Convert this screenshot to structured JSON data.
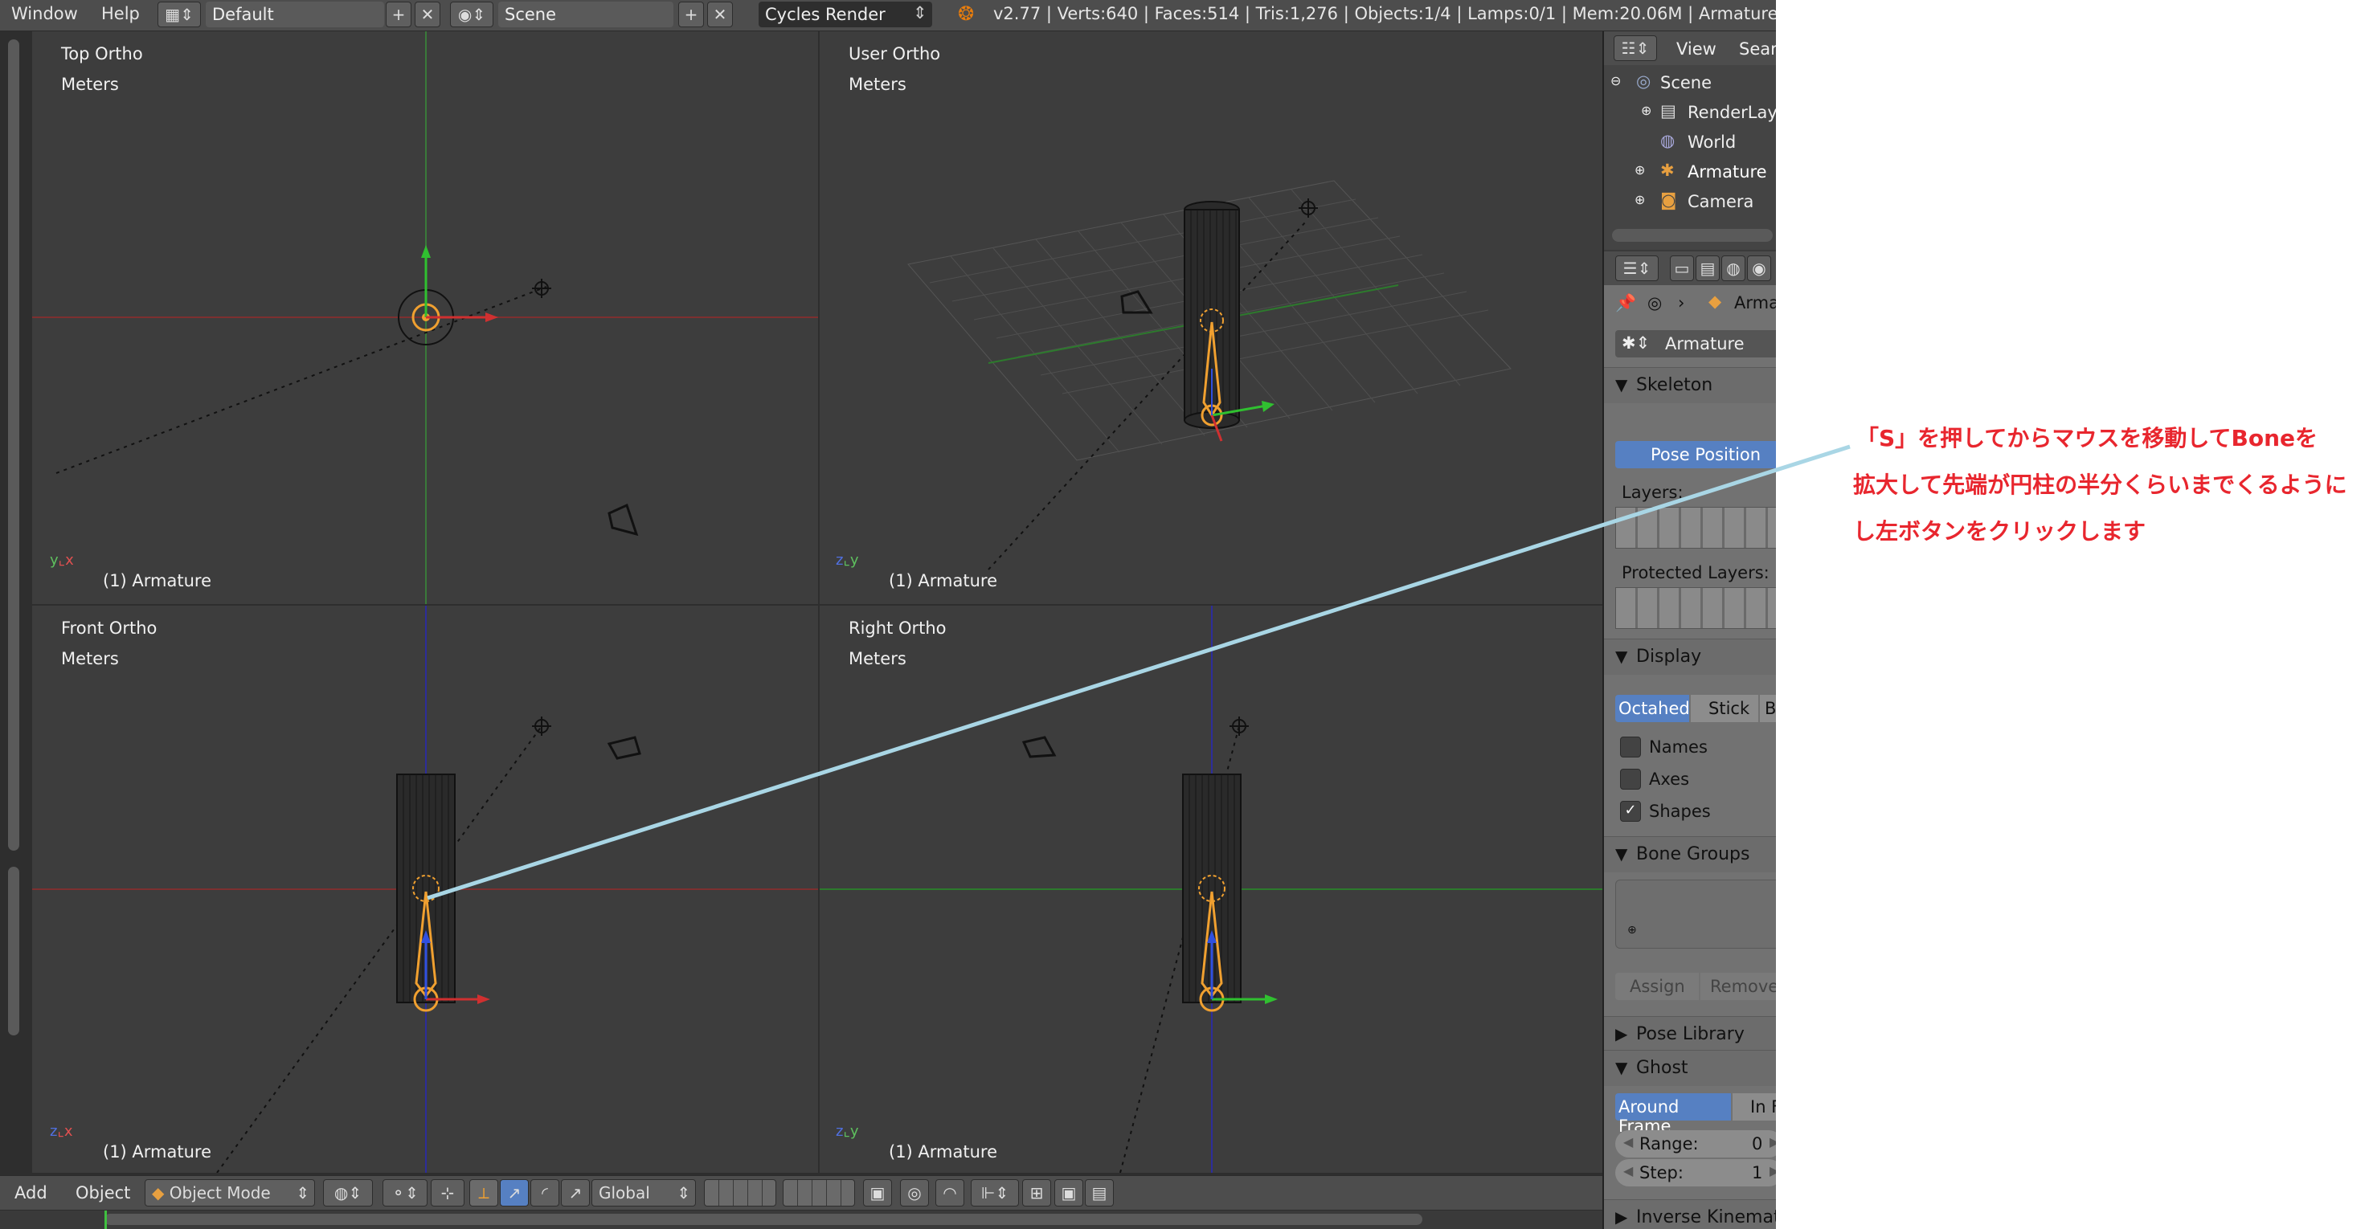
{
  "header": {
    "menu": [
      "Window",
      "Help"
    ],
    "layout": "Default",
    "scene": "Scene",
    "engine": "Cycles Render",
    "stats": "v2.77 | Verts:640 | Faces:514 | Tris:1,276 | Objects:1/4 | Lamps:0/1 | Mem:20.06M | Armature"
  },
  "viewports": [
    {
      "view": "Top Ortho",
      "units": "Meters",
      "object": "(1) Armature"
    },
    {
      "view": "User Ortho",
      "units": "Meters",
      "object": "(1) Armature"
    },
    {
      "view": "Front Ortho",
      "units": "Meters",
      "object": "(1) Armature"
    },
    {
      "view": "Right Ortho",
      "units": "Meters",
      "object": "(1) Armature"
    }
  ],
  "viewport_footer": {
    "menu": [
      "Add",
      "Object"
    ],
    "mode": "Object Mode",
    "orientation": "Global"
  },
  "outliner": {
    "menu": [
      "View",
      "Sear"
    ],
    "items": [
      "Scene",
      "RenderLay",
      "World",
      "Armature",
      "Camera"
    ]
  },
  "properties": {
    "context_object": "Arma",
    "datablock": "Armature",
    "skeleton": {
      "title": "Skeleton",
      "pose_button": "Pose Position",
      "layers_label": "Layers:",
      "protected_label": "Protected Layers:"
    },
    "display": {
      "title": "Display",
      "modes": [
        "Octahed",
        "Stick",
        "B-"
      ],
      "options": [
        {
          "label": "Names",
          "checked": false
        },
        {
          "label": "Axes",
          "checked": false
        },
        {
          "label": "Shapes",
          "checked": true
        }
      ]
    },
    "bone_groups": {
      "title": "Bone Groups",
      "assign": "Assign",
      "remove": "Remove"
    },
    "pose_library": {
      "title": "Pose Library"
    },
    "ghost": {
      "title": "Ghost",
      "modes": [
        "Around Frame",
        "In F"
      ],
      "range_label": "Range:",
      "range_value": "0",
      "step_label": "Step:",
      "step_value": "1"
    },
    "inverse_kinematics": {
      "title": "Inverse Kinemati"
    }
  },
  "annotation": {
    "lines": [
      "「S」を押してからマウスを移動してBoneを",
      "拡大して先端が円柱の半分くらいまでくるように",
      "し左ボタンをクリックします"
    ],
    "color": "#e8262e",
    "line_color": "#a9d6e5"
  },
  "colors": {
    "viewport_bg": "#3d3d3d",
    "panel_bg": "#727272",
    "accent_blue": "#5680c2",
    "bone_orange": "#f0a030"
  }
}
